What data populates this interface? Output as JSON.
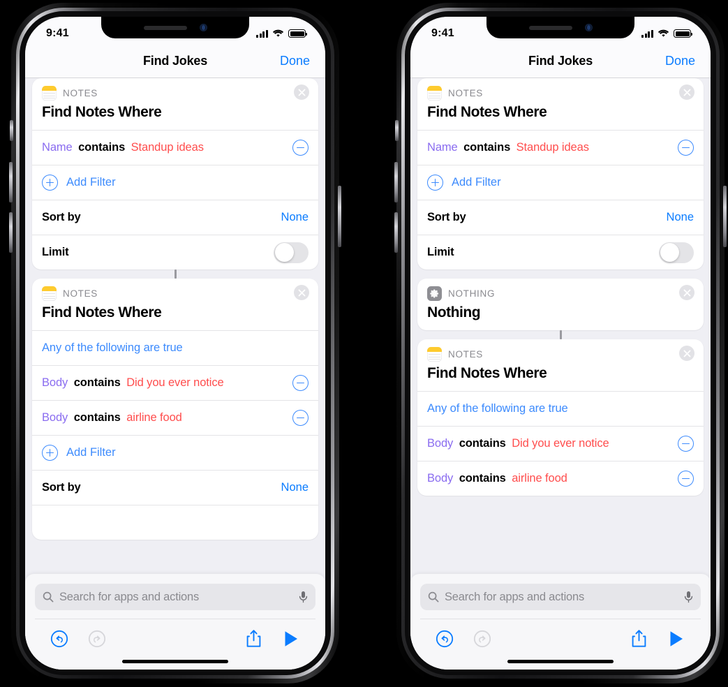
{
  "background_color": "#000000",
  "accent_blue": "#0a7cff",
  "attr_purple": "#8a6cf0",
  "value_red": "#ff4d4d",
  "status_bar": {
    "time": "9:41",
    "cellular_icon": "signal-bars-icon",
    "wifi_icon": "wifi-icon",
    "battery_icon": "battery-full-icon"
  },
  "nav": {
    "title": "Find Jokes",
    "done_label": "Done"
  },
  "search": {
    "placeholder": "Search for apps and actions",
    "search_icon": "search-icon",
    "mic_icon": "microphone-icon"
  },
  "toolbar": {
    "undo_icon": "undo-icon",
    "redo_icon": "redo-icon",
    "share_icon": "share-icon",
    "play_icon": "play-icon"
  },
  "labels": {
    "add_filter": "Add Filter",
    "sort_by": "Sort by",
    "sort_value": "None",
    "limit": "Limit",
    "limit_toggle_state": "off",
    "any_following_true": "Any of the following are true",
    "close_icon": "close-icon",
    "remove_icon": "minus-circle-icon",
    "add_icon": "plus-circle-icon"
  },
  "left_phone": {
    "cards": [
      {
        "app": "NOTES",
        "icon": "notes-app-icon",
        "title": "Find Notes Where",
        "criteria": [
          {
            "attribute": "Name",
            "operator": "contains",
            "value": "Standup ideas"
          }
        ],
        "has_add_filter": true,
        "has_sort": true,
        "has_limit": true
      },
      {
        "app": "NOTES",
        "icon": "notes-app-icon",
        "title": "Find Notes Where",
        "condition": "Any of the following are true",
        "criteria": [
          {
            "attribute": "Body",
            "operator": "contains",
            "value": "Did you ever notice"
          },
          {
            "attribute": "Body",
            "operator": "contains",
            "value": "airline food"
          }
        ],
        "has_add_filter": true,
        "has_sort": true,
        "has_limit": false
      }
    ]
  },
  "right_phone": {
    "cards": [
      {
        "app": "NOTES",
        "icon": "notes-app-icon",
        "title": "Find Notes Where",
        "criteria": [
          {
            "attribute": "Name",
            "operator": "contains",
            "value": "Standup ideas"
          }
        ],
        "has_add_filter": true,
        "has_sort": true,
        "has_limit": true
      },
      {
        "app": "NOTHING",
        "icon": "nothing-gear-icon",
        "title": "Nothing",
        "criteria": [],
        "has_add_filter": false,
        "has_sort": false,
        "has_limit": false
      },
      {
        "app": "NOTES",
        "icon": "notes-app-icon",
        "title": "Find Notes Where",
        "condition": "Any of the following are true",
        "criteria": [
          {
            "attribute": "Body",
            "operator": "contains",
            "value": "Did you ever notice"
          },
          {
            "attribute": "Body",
            "operator": "contains",
            "value": "airline food"
          }
        ],
        "has_add_filter": false,
        "has_sort": false,
        "has_limit": false
      }
    ]
  }
}
